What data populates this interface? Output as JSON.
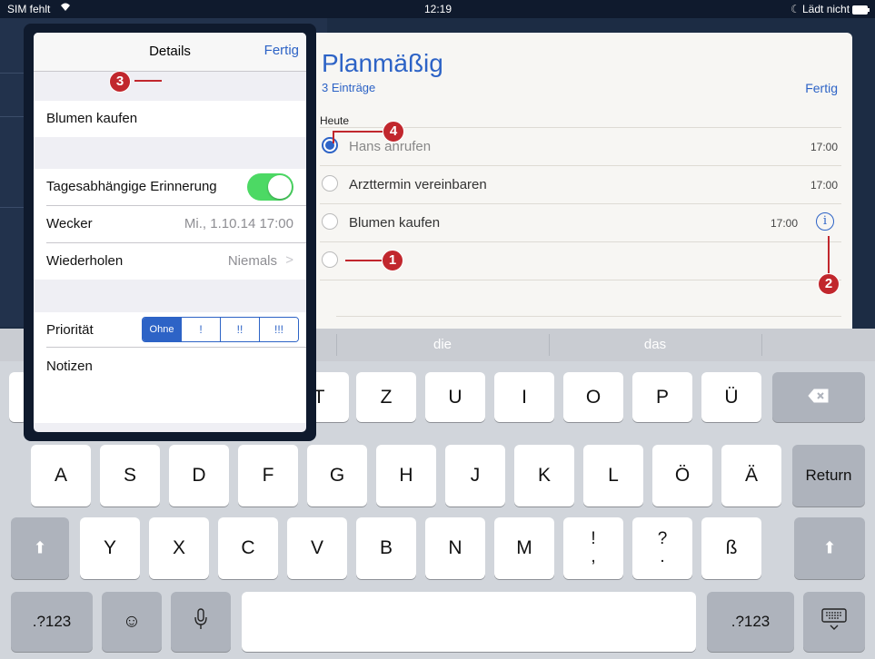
{
  "status_bar": {
    "carrier": "SIM fehlt",
    "time": "12:19",
    "battery": "Lädt nicht"
  },
  "reminders": {
    "title": "Planmäßig",
    "count": "3 Einträge",
    "done": "Fertig",
    "section": "Heute",
    "items": [
      {
        "text": "Hans anrufen",
        "time": "17:00",
        "selected": true
      },
      {
        "text": "Arzttermin vereinbaren",
        "time": "17:00",
        "selected": false
      },
      {
        "text": "Blumen kaufen",
        "time": "17:00",
        "selected": false
      },
      {
        "text": "",
        "time": "",
        "selected": false
      }
    ],
    "info_icon": "i"
  },
  "details": {
    "title": "Details",
    "done": "Fertig",
    "name": "Blumen kaufen",
    "remind_label": "Tagesabhängige Erinnerung",
    "alarm_label": "Wecker",
    "alarm_value": "Mi., 1.10.14 17:00",
    "repeat_label": "Wiederholen",
    "repeat_value": "Niemals",
    "repeat_chevron": ">",
    "priority_label": "Priorität",
    "priority_options": [
      "Ohne",
      "!",
      "!!",
      "!!!"
    ],
    "notes_label": "Notizen"
  },
  "suggestions": [
    "die",
    "das"
  ],
  "keyboard": {
    "row1": [
      "Z",
      "U",
      "I",
      "O",
      "P",
      "Ü"
    ],
    "row2": [
      "A",
      "S",
      "D",
      "F",
      "G",
      "H",
      "J",
      "K",
      "L",
      "Ö",
      "Ä"
    ],
    "return": "Return",
    "row3": [
      "Y",
      "X",
      "C",
      "V",
      "B",
      "N",
      "M",
      "!\n,",
      "?\n.",
      "ß"
    ],
    "numbers": ".?123",
    "numbers_right": ".?123",
    "shift_icon": "⬆",
    "backspace_icon": "⌫",
    "emoji_icon": "☺",
    "mic_icon": "🎙",
    "hide_keyboard_icon": "⌨"
  },
  "callouts": [
    "1",
    "2",
    "3",
    "4"
  ]
}
